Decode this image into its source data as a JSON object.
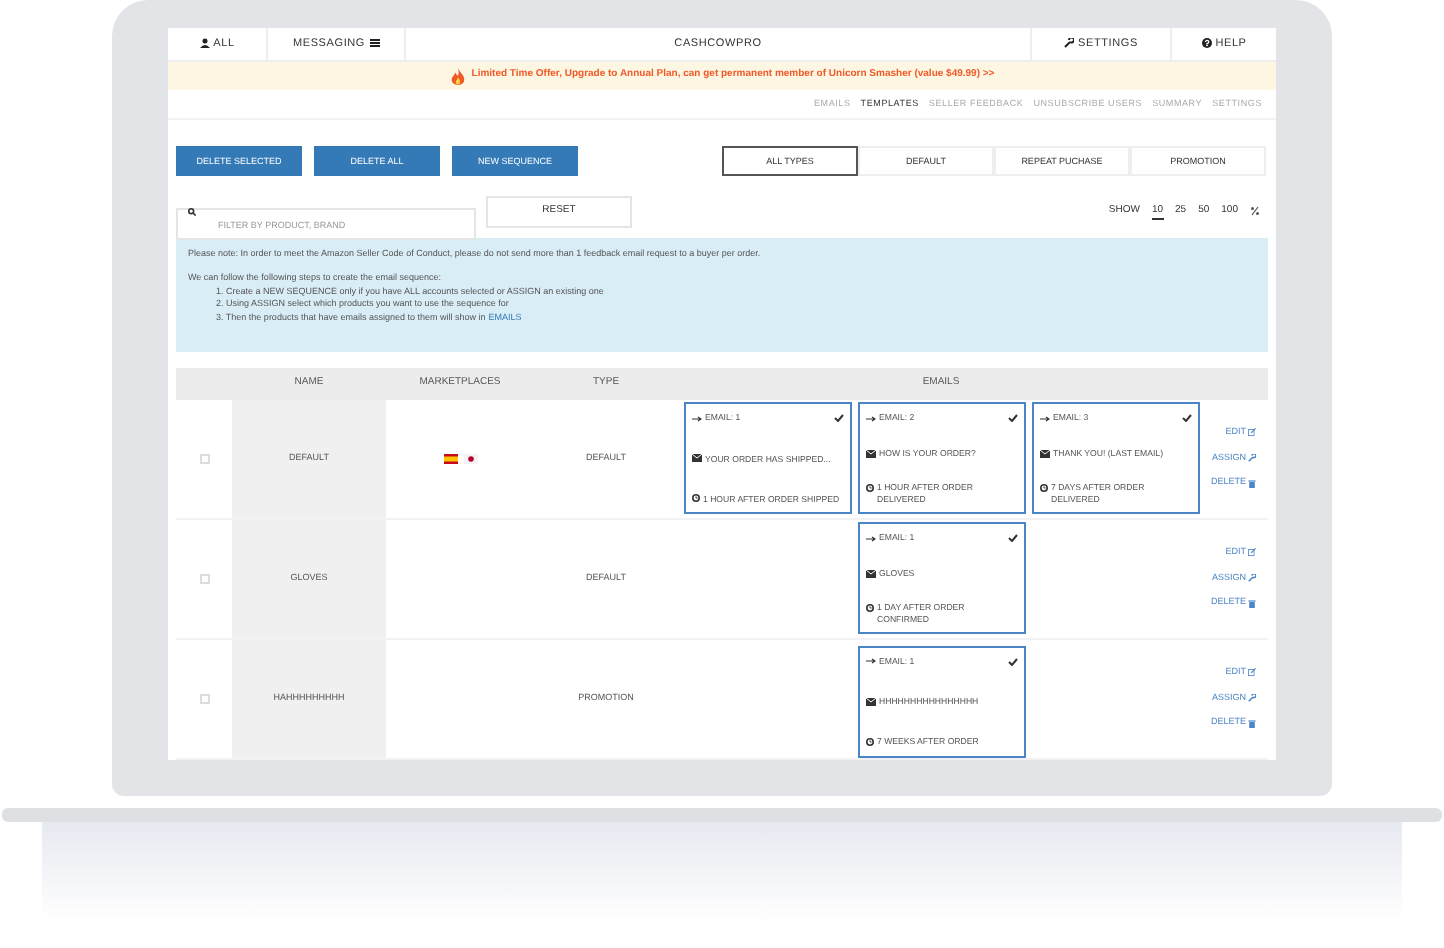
{
  "nav": {
    "items": [
      {
        "label": "ALL",
        "kind": "user"
      },
      {
        "label": "MESSAGING",
        "kind": "menu"
      }
    ],
    "brand": "CASHCOWPRO",
    "right": [
      {
        "label": "SETTINGS",
        "kind": "wrench"
      },
      {
        "label": "HELP",
        "kind": "help"
      }
    ]
  },
  "banner": {
    "text": "Limited Time Offer, Upgrade to Annual Plan, can get permanent member of Unicorn Smasher (value $49.99) >>"
  },
  "subnav": [
    {
      "label": "EMAILS",
      "selected": false
    },
    {
      "label": "TEMPLATES",
      "selected": true
    },
    {
      "label": "SELLER FEEDBACK",
      "selected": false
    },
    {
      "label": "UNSUBSCRIBE USERS",
      "selected": false
    },
    {
      "label": "SUMMARY",
      "selected": false
    },
    {
      "label": "SETTINGS",
      "selected": false
    }
  ],
  "actions": [
    "DELETE SELECTED",
    "DELETE ALL",
    "NEW SEQUENCE"
  ],
  "type_filter": [
    {
      "label": "ALL TYPES",
      "selected": true
    },
    {
      "label": "DEFAULT",
      "selected": false
    },
    {
      "label": "REPEAT PUCHASE",
      "selected": false
    },
    {
      "label": "PROMOTION",
      "selected": false
    }
  ],
  "search": {
    "placeholder": "FILTER BY PRODUCT, BRAND"
  },
  "reset": "RESET",
  "show": {
    "label": "SHOW",
    "options": [
      {
        "label": "10",
        "selected": true
      },
      {
        "label": "25",
        "selected": false
      },
      {
        "label": "50",
        "selected": false
      },
      {
        "label": "100",
        "selected": false
      }
    ]
  },
  "notice": {
    "intro": "Please note: In order to meet the Amazon Seller Code of Conduct, please do not send more than 1 feedback email request to a buyer per order.",
    "lead": "We can follow the following steps to create the email sequence:",
    "steps": [
      "1. Create a NEW SEQUENCE only if you have ALL accounts selected or ASSIGN an existing one",
      "2. Using ASSIGN select which products you want to use the sequence for"
    ],
    "last_step": "3. Then the products that have emails assigned to them will show in",
    "last_link": "EMAILS"
  },
  "table": {
    "columns": [
      "NAME",
      "MARKETPLACES",
      "TYPE",
      "EMAILS"
    ],
    "rows": [
      {
        "checked": false,
        "name": "DEFAULT",
        "marketplaces": [
          {
            "kind": "es"
          },
          {
            "kind": "jp"
          }
        ],
        "type": "DEFAULT",
        "emails": [
          {
            "title": "EMAIL: 1",
            "subject": "YOUR ORDER HAS SHIPPED...",
            "timing": "1 HOUR AFTER ORDER SHIPPED"
          },
          {
            "title": "EMAIL: 2",
            "subject": "HOW IS YOUR ORDER?",
            "timing": "1 HOUR AFTER ORDER DELIVERED"
          },
          {
            "title": "EMAIL: 3",
            "subject": "THANK YOU! (LAST EMAIL)",
            "timing": "7 DAYS AFTER ORDER DELIVERED"
          }
        ],
        "links": [
          "EDIT",
          "ASSIGN",
          "DELETE"
        ]
      },
      {
        "checked": false,
        "name": "GLOVES",
        "marketplaces": [],
        "type": "DEFAULT",
        "emails": [
          {
            "title": "EMAIL: 1",
            "subject": "GLOVES",
            "timing": "1 DAY AFTER ORDER CONFIRMED"
          }
        ],
        "links": [
          "EDIT",
          "ASSIGN",
          "DELETE"
        ]
      },
      {
        "checked": false,
        "name": "HAHHHHHHHHH",
        "marketplaces": [],
        "type": "PROMOTION",
        "emails": [
          {
            "title": "EMAIL: 1",
            "subject": "HHHHHHHHHHHHHHHH",
            "timing": "7 WEEKS AFTER ORDER"
          }
        ],
        "links": [
          "EDIT",
          "ASSIGN",
          "DELETE"
        ]
      }
    ]
  }
}
